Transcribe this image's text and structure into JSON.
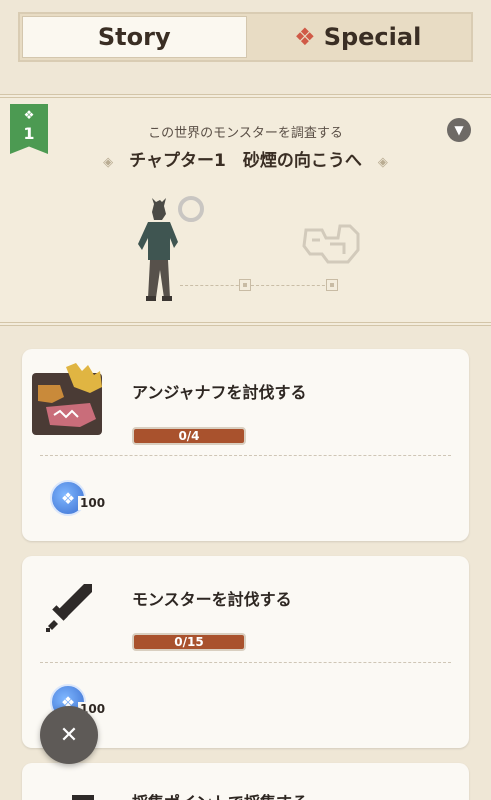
{
  "tabs": [
    {
      "label": "Story",
      "active": true
    },
    {
      "label": "Special",
      "icon": "crest-icon",
      "active": false
    }
  ],
  "chapter": {
    "badge_number": "1",
    "subtitle": "この世界のモンスターを調査する",
    "title": "チャプター1　砂煙の向こうへ"
  },
  "quests": [
    {
      "title": "アンジャナフを討伐する",
      "progress": "0/4",
      "progress_value": 0.0,
      "reward_qty": "100",
      "icon": "anjanath-icon"
    },
    {
      "title": "モンスターを討伐する",
      "progress": "0/15",
      "progress_value": 0.0,
      "reward_qty": "100",
      "icon": "sword-icon"
    },
    {
      "title": "採集ポイントで採集する",
      "icon": "gather-icon"
    }
  ],
  "colors": {
    "accent_red": "#d05a47",
    "badge_green": "#4c9a52",
    "progress_brown": "#a9522d",
    "reward_blue": "#3b6fd0"
  }
}
